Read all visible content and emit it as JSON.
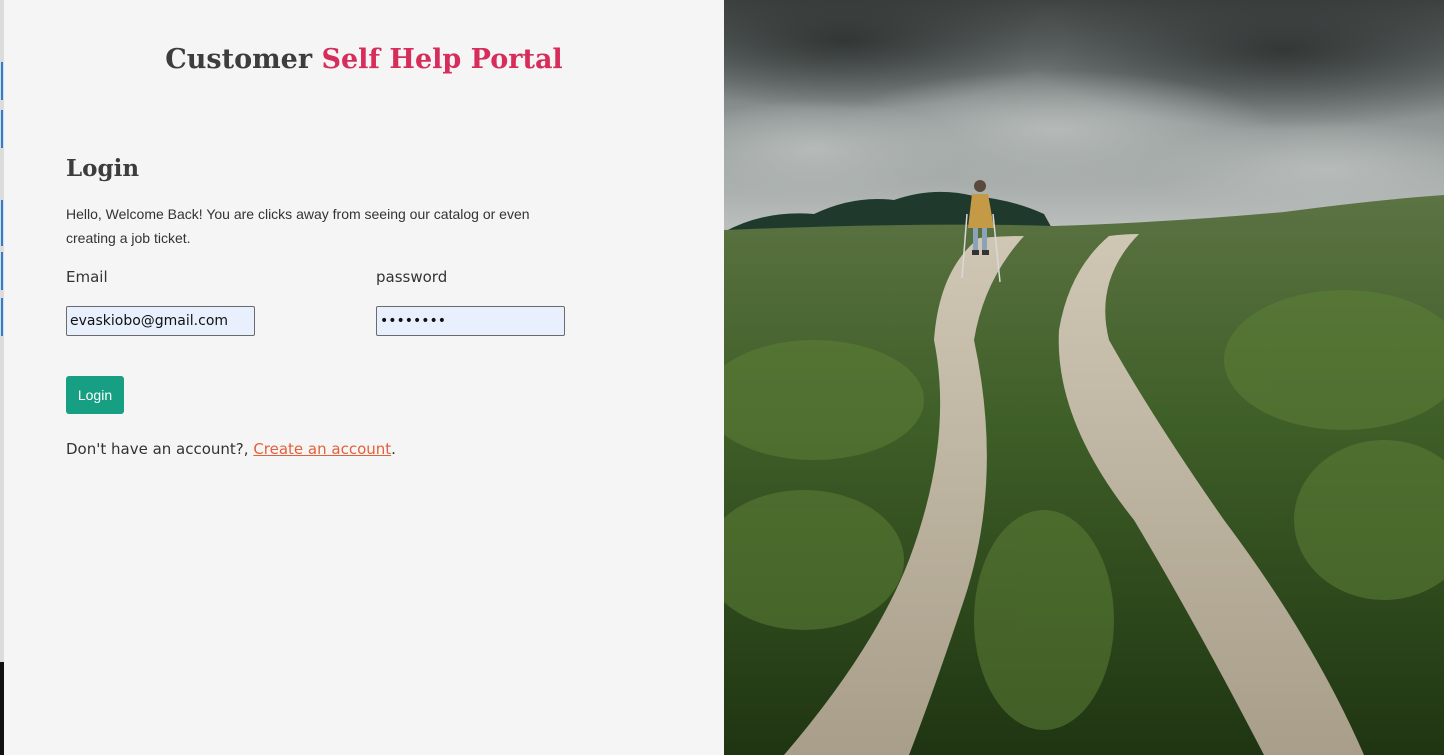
{
  "header": {
    "title_part1": "Customer",
    "title_part2": "Self Help Portal"
  },
  "login": {
    "heading": "Login",
    "welcome": "Hello, Welcome Back! You are clicks away from seeing our catalog or even creating a job ticket.",
    "email_label": "Email",
    "email_value": "evaskiobo@gmail.com",
    "password_label": "password",
    "password_value": "••••••••",
    "button_label": "Login",
    "signup_prompt": "Don't have an account?, ",
    "signup_link": "Create an account",
    "signup_suffix": "."
  },
  "colors": {
    "accent_title": "#d62d5b",
    "button": "#179f83",
    "link": "#e2613c",
    "input_background": "#e8f0fe"
  },
  "hero_image": {
    "subject": "person walking with trekking poles on a dirt path through a grassy hillside under a cloudy sky"
  }
}
